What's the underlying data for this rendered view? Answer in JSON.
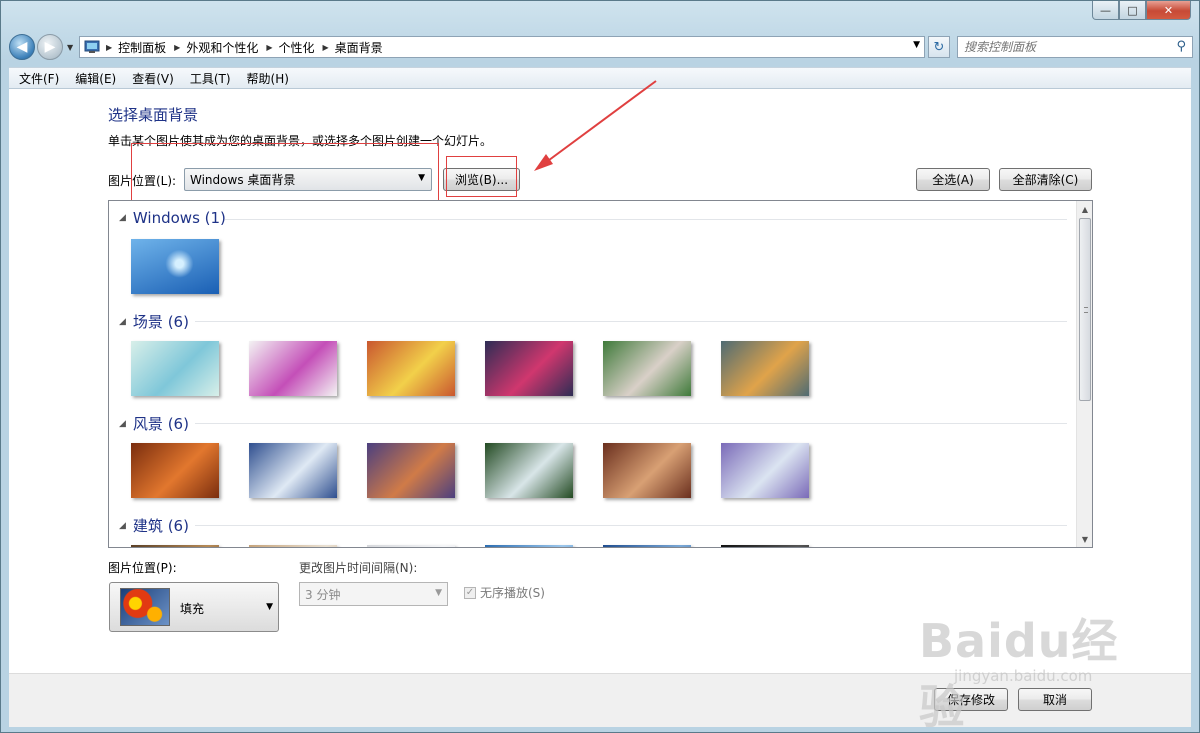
{
  "window": {
    "controls": {
      "minimize": "—",
      "maximize": "□",
      "close": "✕"
    }
  },
  "address_bar": {
    "breadcrumbs": [
      "控制面板",
      "外观和个性化",
      "个性化",
      "桌面背景"
    ],
    "search_placeholder": "搜索控制面板"
  },
  "menu": {
    "items": [
      "文件(F)",
      "编辑(E)",
      "查看(V)",
      "工具(T)",
      "帮助(H)"
    ]
  },
  "page": {
    "title": "选择桌面背景",
    "description": "单击某个图片使其成为您的桌面背景，或选择多个图片创建一个幻灯片。",
    "location_label": "图片位置(L):",
    "location_value": "Windows 桌面背景",
    "browse_button": "浏览(B)...",
    "select_all_button": "全选(A)",
    "clear_all_button": "全部清除(C)"
  },
  "gallery": {
    "groups": [
      {
        "name": "Windows (1)",
        "thumbs": [
          [
            "#1a5fb4",
            "#6fb3ea"
          ]
        ]
      },
      {
        "name": "场景 (6)",
        "thumbs": [
          [
            "#d8efe9",
            "#7fc7d9"
          ],
          [
            "#f3f3f3",
            "#c44fb8"
          ],
          [
            "#c9572f",
            "#f2d04a"
          ],
          [
            "#2e2d55",
            "#d0376e"
          ],
          [
            "#3f7a3a",
            "#d9d0c8"
          ],
          [
            "#4f6b73",
            "#e0a34a"
          ]
        ]
      },
      {
        "name": "风景 (6)",
        "thumbs": [
          [
            "#7a2d0e",
            "#e2772e"
          ],
          [
            "#2f4f8f",
            "#dfe9f4"
          ],
          [
            "#4b3f7f",
            "#d07b48"
          ],
          [
            "#234a22",
            "#d8e5e8"
          ],
          [
            "#6a2f1e",
            "#d8a074"
          ],
          [
            "#7a6ab8",
            "#dbe4f1"
          ]
        ]
      },
      {
        "name": "建筑 (6)",
        "thumbs": [
          [
            "#5a3f25",
            "#b68a56"
          ],
          [
            "#c5a37a",
            "#e9e0d2"
          ],
          [
            "#d6d8dc",
            "#f5f6f8"
          ],
          [
            "#2b6cb0",
            "#9cc7ec"
          ],
          [
            "#1f4d8f",
            "#7aa8d6"
          ],
          [
            "#111111",
            "#555555"
          ]
        ]
      }
    ]
  },
  "bottom": {
    "position_label": "图片位置(P):",
    "position_value": "填充",
    "interval_label": "更改图片时间间隔(N):",
    "interval_value": "3 分钟",
    "shuffle_label": "无序播放(S)",
    "shuffle_checked": "✓",
    "save_button": "保存修改",
    "cancel_button": "取消"
  },
  "watermark": {
    "text": "Baidu经验",
    "url": "jingyan.baidu.com"
  },
  "colors": {
    "title_blue": "#1e3287",
    "highlight_red": "#e04040"
  }
}
